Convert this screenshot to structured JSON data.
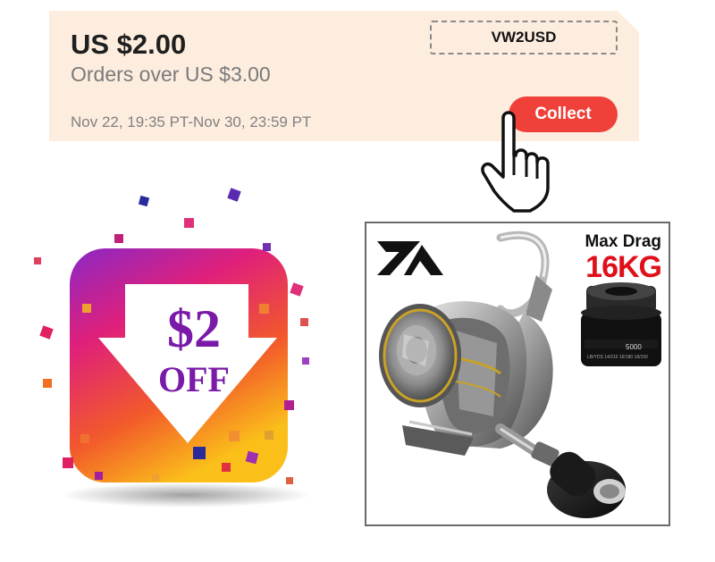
{
  "coupon": {
    "amount": "US $2.00",
    "condition": "Orders over US $3.00",
    "validity": "Nov 22, 19:35 PT-Nov 30, 23:59 PT",
    "code": "VW2USD",
    "collect_label": "Collect",
    "background_color": "#fdeddf",
    "button_color": "#f0403a"
  },
  "promo": {
    "price": "$2",
    "off": "OFF",
    "icon": "download-arrow-icon"
  },
  "product": {
    "max_drag_label": "Max Drag",
    "max_drag_value": "16KG",
    "spool_size": "5000",
    "spool_capacity": "LB/YDS 14/210 16/180 18/150",
    "brand_icon": "brand-logo-icon"
  },
  "pointer": {
    "icon": "hand-pointer-icon"
  }
}
